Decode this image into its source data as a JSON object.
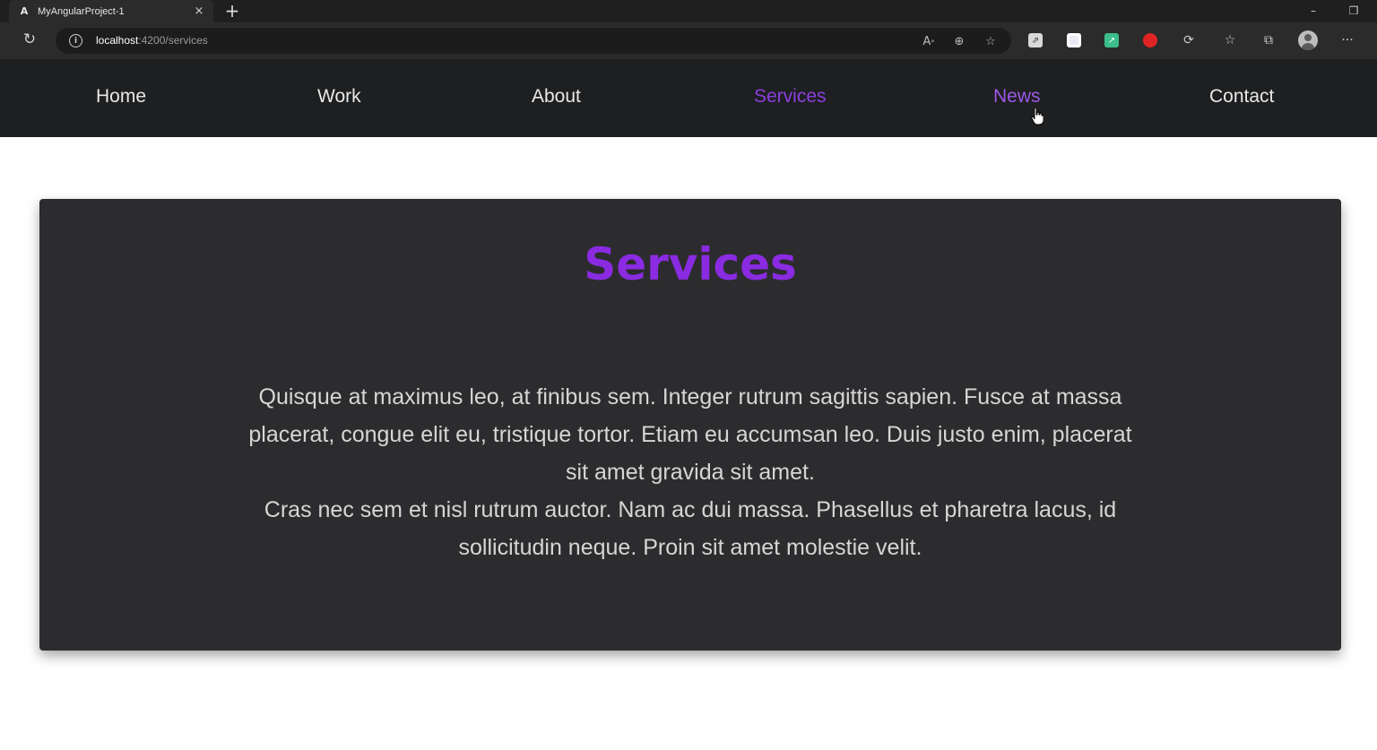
{
  "browser": {
    "tab_title": "MyAngularProject-1",
    "tab_favicon": "A",
    "tab_close": "×",
    "new_tab": "+",
    "minimize": "–",
    "restore": "❐",
    "url_host": "localhost",
    "url_rest": ":4200/services",
    "icons": [
      "reload-icon",
      "site-info-icon",
      "read-aloud-icon",
      "zoom-icon",
      "add-favorite-icon",
      "extension-icons",
      "refresh-extension-icon",
      "favorites-icon",
      "collections-icon",
      "profile-avatar",
      "more-icon"
    ]
  },
  "nav": {
    "items": [
      {
        "label": "Home"
      },
      {
        "label": "Work"
      },
      {
        "label": "About"
      },
      {
        "label": "Services"
      },
      {
        "label": "News"
      },
      {
        "label": "Contact"
      }
    ],
    "active": "Services",
    "hovered": "News",
    "colors": {
      "default": "#e8e8e8",
      "active": "#8a3fe0",
      "background": "#1e1f21"
    }
  },
  "content": {
    "title": "Services",
    "paragraph_1": "Quisque at maximus leo, at finibus sem. Integer rutrum sagittis sapien. Fusce at massa placerat, congue elit eu, tristique tortor. Etiam eu accumsan leo. Duis justo enim, placerat sit amet gravida sit amet.",
    "paragraph_2": "Cras nec sem et nisl rutrum auctor. Nam ac dui massa. Phasellus et pharetra lacus, id sollicitudin neque. Proin sit amet molestie velit.",
    "colors": {
      "title": "#8a2be2",
      "card": "#2c2c2e",
      "text": "#d6d6d6"
    }
  }
}
